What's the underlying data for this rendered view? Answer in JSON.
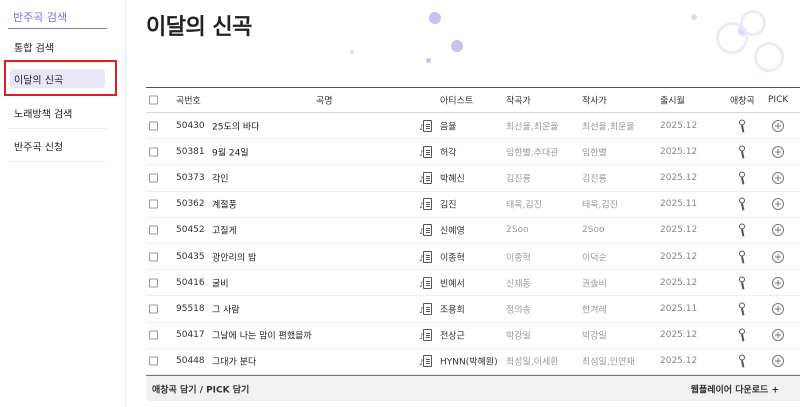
{
  "sidebar": {
    "title": "반주곡 검색",
    "items": [
      {
        "label": "통합 검색"
      },
      {
        "label": "이달의 신곡"
      },
      {
        "label": "노래방책 검색"
      },
      {
        "label": "반주곡 신청"
      }
    ],
    "active_index": 1,
    "highlight_color": "#e11d1d"
  },
  "page": {
    "title": "이달의 신곡",
    "accent": "#7b6fd6"
  },
  "table": {
    "headers": {
      "number": "곡번호",
      "title": "곡명",
      "artist": "아티스트",
      "composer": "작곡가",
      "lyricist": "작사가",
      "release": "출시월",
      "favorite": "애창곡",
      "pick": "PICK"
    },
    "rows": [
      {
        "number": "50430",
        "title": "25도의 바다",
        "artist": "음율",
        "composer": "최선율,최운율",
        "lyricist": "최선율,최운율",
        "release": "2025.12"
      },
      {
        "number": "50381",
        "title": "9월 24일",
        "artist": "허각",
        "composer": "임한별,추대관",
        "lyricist": "임한별",
        "release": "2025.12"
      },
      {
        "number": "50373",
        "title": "각인",
        "artist": "박혜신",
        "composer": "김진룡",
        "lyricist": "김진룡",
        "release": "2025.12"
      },
      {
        "number": "50362",
        "title": "계절풍",
        "artist": "김진",
        "composer": "태욱,김진",
        "lyricist": "태욱,김진",
        "release": "2025.11"
      },
      {
        "number": "50452",
        "title": "고칠게",
        "artist": "신예영",
        "composer": "2Soo",
        "lyricist": "2Soo",
        "release": "2025.12"
      },
      {
        "number": "50435",
        "title": "광안리의 밤",
        "artist": "이종혁",
        "composer": "이종혁",
        "lyricist": "이덕순",
        "release": "2025.12"
      },
      {
        "number": "50416",
        "title": "굴비",
        "artist": "빈예서",
        "composer": "신재동",
        "lyricist": "권솔비",
        "release": "2025.12"
      },
      {
        "number": "95518",
        "title": "그 사람",
        "artist": "조용희",
        "composer": "정의송",
        "lyricist": "한겨레",
        "release": "2025.11"
      },
      {
        "number": "50417",
        "title": "그날에 나는 맘이 편했을까",
        "artist": "전상근",
        "composer": "박강일",
        "lyricist": "박강일",
        "release": "2025.12"
      },
      {
        "number": "50448",
        "title": "그대가 분다",
        "artist": "HYNN(박혜원)",
        "composer": "최성일,이세환",
        "lyricist": "최성일,인연재",
        "release": "2025.12"
      }
    ]
  },
  "footer": {
    "left_label": "애창곡 담기 / PICK 담기",
    "right_label": "웹플레이어 다운로드 +"
  }
}
